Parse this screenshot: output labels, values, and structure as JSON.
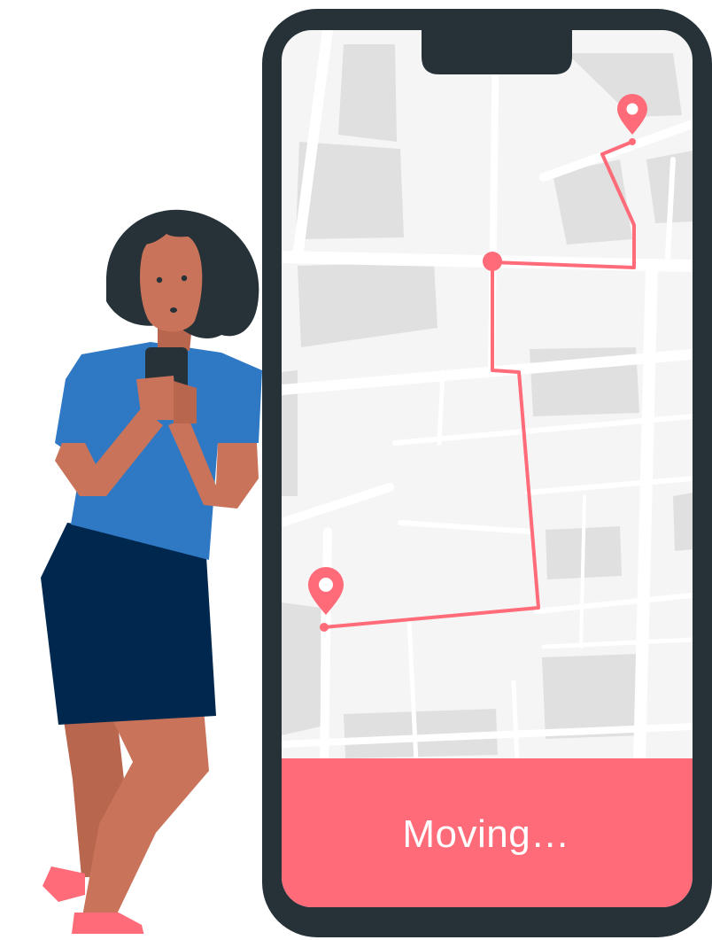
{
  "status": {
    "label": "Moving…"
  },
  "colors": {
    "phone_frame": "#263238",
    "map_background": "#f5f5f5",
    "map_block": "#e0e0e0",
    "route": "#ff6b78",
    "status_bar": "#ff6b78",
    "shirt": "#2f78c4",
    "skirt": "#00284f",
    "skin": "#c9735a",
    "hair": "#263238",
    "sneaker": "#ff6b78"
  },
  "icons": [
    "start-pin-icon",
    "destination-pin-icon",
    "waypoint-dot-icon"
  ]
}
